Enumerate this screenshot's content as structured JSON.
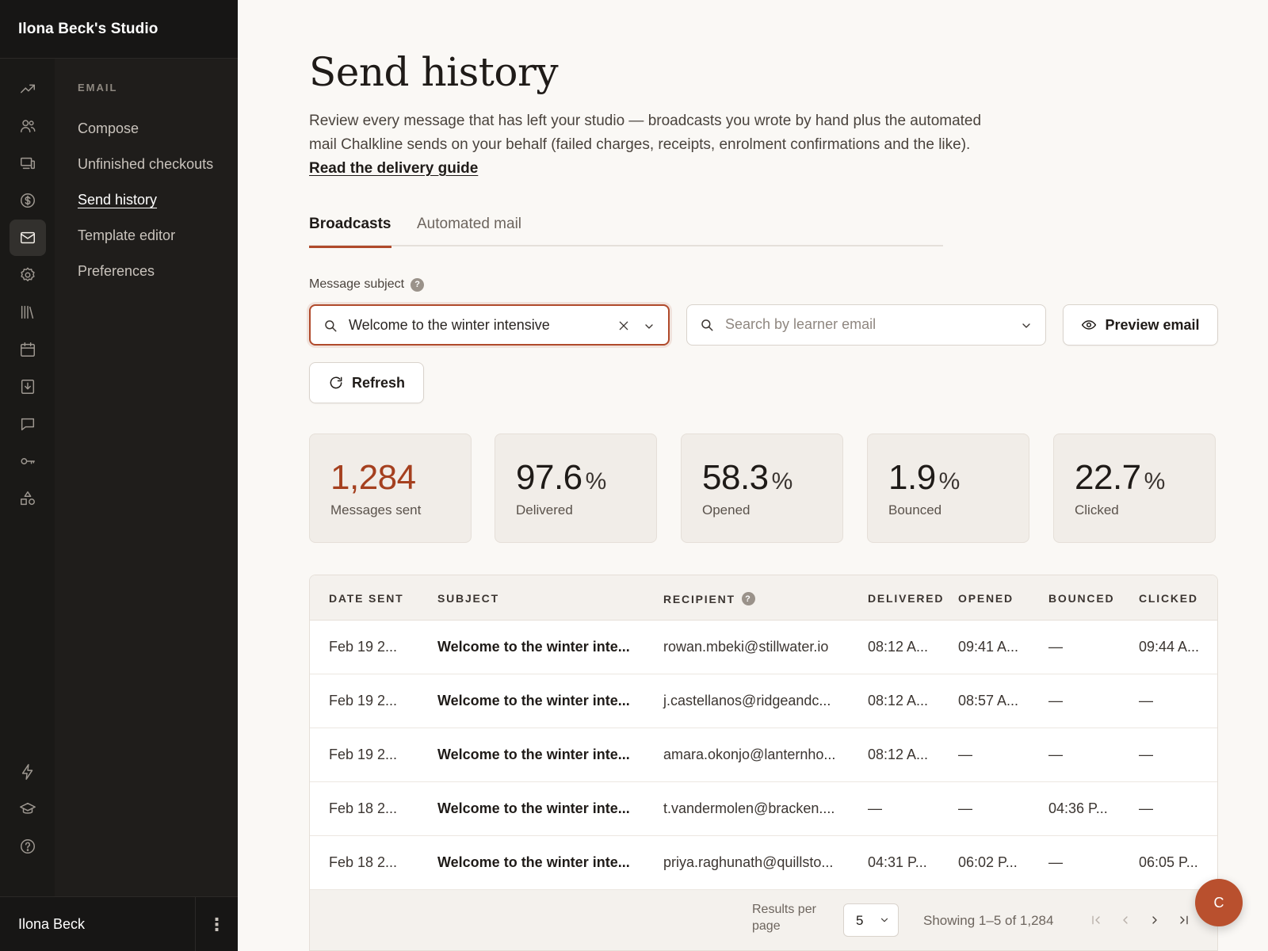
{
  "studio": {
    "name": "Ilona Beck's Studio"
  },
  "sidebar": {
    "section": "EMAIL",
    "items": [
      {
        "label": "Compose"
      },
      {
        "label": "Unfinished checkouts"
      },
      {
        "label": "Send history"
      },
      {
        "label": "Template editor"
      },
      {
        "label": "Preferences"
      }
    ],
    "rail_icons": [
      "trend-icon",
      "people-icon",
      "devices-icon",
      "dollar-icon",
      "mail-icon",
      "gear-icon",
      "library-icon",
      "calendar-icon",
      "download-icon",
      "chat-icon",
      "key-icon",
      "shapes-icon",
      "bolt-icon",
      "graduation-cap-icon",
      "help-icon"
    ],
    "active_rail_icon": "mail-icon"
  },
  "user": {
    "name": "Ilona Beck",
    "menu_glyph": "⋮"
  },
  "page": {
    "title": "Send history",
    "description": "Review every message that has left your studio — broadcasts you wrote by hand plus the automated mail Chalkline sends on your behalf (failed charges, receipts, enrolment confirmations and the like).",
    "guide_link": "Read the delivery guide"
  },
  "tabs": [
    {
      "label": "Broadcasts",
      "active": true
    },
    {
      "label": "Automated mail",
      "active": false
    }
  ],
  "filters": {
    "subject_label": "Message subject",
    "help_glyph": "?",
    "subject_value": "Welcome to the winter intensive",
    "email_placeholder": "Search by learner email"
  },
  "buttons": {
    "preview": "Preview email",
    "refresh": "Refresh"
  },
  "stats": [
    {
      "value": "1,284",
      "unit": "",
      "label": "Messages sent"
    },
    {
      "value": "97.6",
      "unit": "%",
      "label": "Delivered"
    },
    {
      "value": "58.3",
      "unit": "%",
      "label": "Opened"
    },
    {
      "value": "1.9",
      "unit": "%",
      "label": "Bounced"
    },
    {
      "value": "22.7",
      "unit": "%",
      "label": "Clicked"
    }
  ],
  "table": {
    "headers": [
      "DATE SENT",
      "SUBJECT",
      "RECIPIENT",
      "DELIVERED",
      "OPENED",
      "BOUNCED",
      "CLICKED"
    ],
    "rows": [
      [
        "Feb 19 2...",
        "Welcome to the winter inte...",
        "rowan.mbeki@stillwater.io",
        "08:12 A...",
        "09:41 A...",
        "—",
        "09:44 A..."
      ],
      [
        "Feb 19 2...",
        "Welcome to the winter inte...",
        "j.castellanos@ridgeandc...",
        "08:12 A...",
        "08:57 A...",
        "—",
        "—"
      ],
      [
        "Feb 19 2...",
        "Welcome to the winter inte...",
        "amara.okonjo@lanternho...",
        "08:12 A...",
        "—",
        "—",
        "—"
      ],
      [
        "Feb 18 2...",
        "Welcome to the winter inte...",
        "t.vandermolen@bracken....",
        "—",
        "—",
        "04:36 P...",
        "—"
      ],
      [
        "Feb 18 2...",
        "Welcome to the winter inte...",
        "priya.raghunath@quillsto...",
        "04:31 P...",
        "06:02 P...",
        "—",
        "06:05 P..."
      ]
    ],
    "footer": {
      "results_per_page_label": "Results per page",
      "results_per_page_value": "5",
      "showing": "Showing 1–5 of 1,284"
    }
  },
  "fab": {
    "label": "C"
  },
  "colors": {
    "accent": "#b04a2b",
    "sidebar_bg": "#1f1d1b",
    "page_bg": "#faf8f5"
  }
}
